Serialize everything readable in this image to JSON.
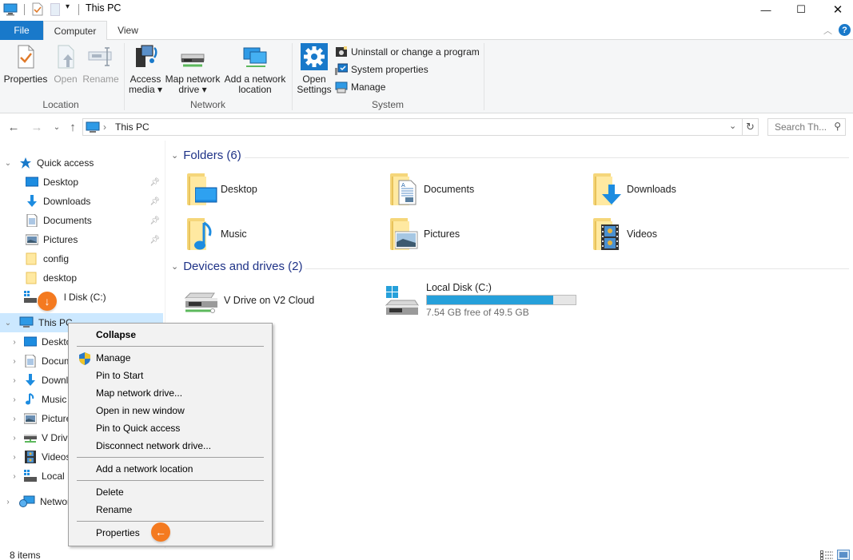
{
  "window": {
    "title": "This PC",
    "controls": {
      "minimize": "—",
      "maximize": "☐",
      "close": "✕"
    }
  },
  "ribbon": {
    "tabs": [
      {
        "label": "File",
        "active": false
      },
      {
        "label": "Computer",
        "active": true
      },
      {
        "label": "View",
        "active": false
      }
    ],
    "groups": {
      "location": {
        "label": "Location",
        "buttons": [
          {
            "label": "Properties",
            "enabled": true
          },
          {
            "label": "Open",
            "enabled": false
          },
          {
            "label": "Rename",
            "enabled": false
          }
        ]
      },
      "network": {
        "label": "Network",
        "buttons": [
          {
            "label_line1": "Access",
            "label_line2": "media ▾"
          },
          {
            "label_line1": "Map network",
            "label_line2": "drive ▾"
          },
          {
            "label_line1": "Add a network",
            "label_line2": "location"
          }
        ]
      },
      "system": {
        "label": "System",
        "open_settings_line1": "Open",
        "open_settings_line2": "Settings",
        "small_buttons": [
          {
            "label": "Uninstall or change a program"
          },
          {
            "label": "System properties"
          },
          {
            "label": "Manage"
          }
        ]
      }
    }
  },
  "address": {
    "breadcrumb_sep": "›",
    "path": "This PC",
    "search_placeholder": "Search Th..."
  },
  "navpane": {
    "quick_access": {
      "label": "Quick access",
      "items": [
        {
          "label": "Desktop",
          "pinned": true
        },
        {
          "label": "Downloads",
          "pinned": true
        },
        {
          "label": "Documents",
          "pinned": true
        },
        {
          "label": "Pictures",
          "pinned": true
        },
        {
          "label": "config",
          "pinned": false
        },
        {
          "label": "desktop",
          "pinned": false
        },
        {
          "label": "Local Disk (C:)",
          "pinned": false,
          "visible_label": "l Disk (C:)"
        }
      ]
    },
    "this_pc": {
      "label": "This PC",
      "children": [
        {
          "label": "Desktop"
        },
        {
          "label": "Documents"
        },
        {
          "label": "Downloads"
        },
        {
          "label": "Music"
        },
        {
          "label": "Pictures"
        },
        {
          "label": "V Drive"
        },
        {
          "label": "Videos"
        },
        {
          "label": "Local Disk"
        }
      ]
    },
    "network": {
      "label": "Network"
    }
  },
  "content": {
    "folders": {
      "header": "Folders (6)",
      "items": [
        {
          "label": "Desktop",
          "icon": "desktop-folder-icon"
        },
        {
          "label": "Documents",
          "icon": "documents-folder-icon"
        },
        {
          "label": "Downloads",
          "icon": "downloads-folder-icon"
        },
        {
          "label": "Music",
          "icon": "music-folder-icon"
        },
        {
          "label": "Pictures",
          "icon": "pictures-folder-icon"
        },
        {
          "label": "Videos",
          "icon": "videos-folder-icon"
        }
      ]
    },
    "drives": {
      "header": "Devices and drives (2)",
      "items": [
        {
          "label": "V Drive on V2 Cloud",
          "type": "network"
        },
        {
          "label": "Local Disk (C:)",
          "type": "local",
          "free_text": "7.54 GB free of 49.5 GB",
          "used_fraction": 0.848
        }
      ]
    }
  },
  "context_menu": {
    "items": [
      {
        "label": "Collapse",
        "bold": true
      },
      {
        "separator": true
      },
      {
        "label": "Manage",
        "icon": "uac-shield-icon"
      },
      {
        "label": "Pin to Start"
      },
      {
        "label": "Map network drive..."
      },
      {
        "label": "Open in new window"
      },
      {
        "label": "Pin to Quick access"
      },
      {
        "label": "Disconnect network drive..."
      },
      {
        "separator": true
      },
      {
        "label": "Add a network location"
      },
      {
        "separator": true
      },
      {
        "label": "Delete"
      },
      {
        "label": "Rename"
      },
      {
        "separator": true
      },
      {
        "label": "Properties"
      }
    ]
  },
  "annotations": {
    "badge_down": "↓",
    "badge_left": "←"
  },
  "status": {
    "item_count": "8 items"
  },
  "colors": {
    "accent": "#1979ca",
    "selection": "#cce8ff",
    "badge": "#f47a20",
    "usage_bar": "#26a0da"
  }
}
